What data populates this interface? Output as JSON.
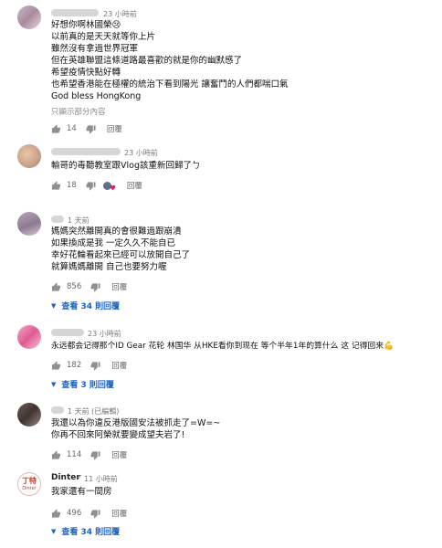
{
  "comments": [
    {
      "meta": "23 小時前",
      "lines": [
        "好想你啊林國榮😢",
        "以前真的是天天就等你上片",
        "雖然沒有拿過世界冠軍",
        "但在英雄聯盟這條道路最喜歡的就是你的幽默感了",
        "希望疫情快點好轉",
        "也希望香港能在極權的統治下看到陽光 讓奮鬥的人們都喘口氣",
        "God bless HongKong"
      ],
      "more": "只顯示部分內容",
      "likes": "14",
      "reply": "回覆"
    },
    {
      "meta": "23 小時前",
      "lines": [
        "輸哥的毒聽教室跟Vlog該重新回歸了ㄅ"
      ],
      "likes": "18",
      "reply": "回覆"
    },
    {
      "meta": "1 天前",
      "lines": [
        "媽媽突然離開真的會很難過跟崩潰",
        "如果換成是我 一定久久不能自已",
        "幸好花輪看起來已經可以放開自己了",
        "就算媽媽離開 自己也要努力喔"
      ],
      "likes": "856",
      "reply": "回覆",
      "view": "查看 34 則回覆"
    },
    {
      "meta": "23 小時前",
      "lines": [
        "永远都会记得那个ID Gear 花轮 林国华 从HKE看你到现在 等个半年1年的算什么 这 记得回来💪"
      ],
      "likes": "182",
      "reply": "回覆",
      "view": "查看 3 則回覆"
    },
    {
      "meta": "1 天前 (已編輯)",
      "lines": [
        "我還以為你違反港版國安法被抓走了=W=~",
        "你再不回來阿榮就要變成望夫岩了!"
      ],
      "likes": "114",
      "reply": "回覆"
    },
    {
      "author": "Dinter",
      "check": "✓",
      "meta": "11 小時前",
      "avatar_text_top": "丁特",
      "avatar_text_bottom": "Dinter",
      "lines": [
        "我家還有一間房"
      ],
      "likes": "496",
      "reply": "回覆",
      "view": "查看 34 則回覆"
    }
  ],
  "colors": {
    "link": "#1a63c9",
    "meta": "#777777",
    "heart": "#e0245e"
  },
  "icons": {
    "like": "thumb-up-icon",
    "dislike": "thumb-down-icon",
    "heart": "heart-icon",
    "caret": "caret-down-icon"
  }
}
